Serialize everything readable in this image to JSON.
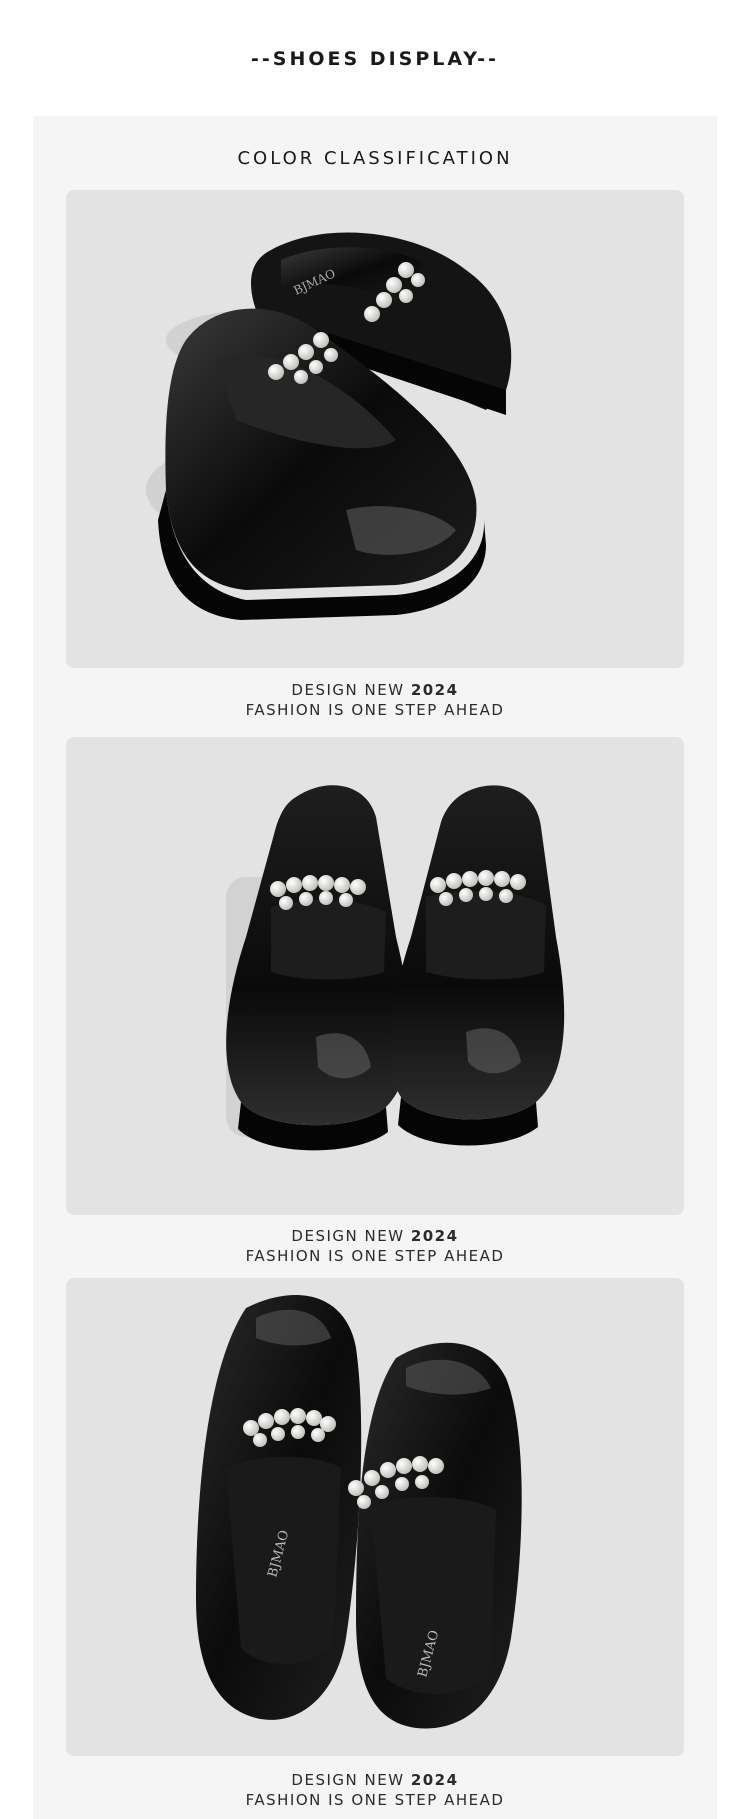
{
  "header": {
    "title": "--SHOES DISPLAY--"
  },
  "section": {
    "title": "COLOR CLASSIFICATION"
  },
  "brand": {
    "logo_text": "BJMAO"
  },
  "products": [
    {
      "view": "side-angle",
      "caption_line1_prefix": "DESIGN NEW ",
      "caption_line1_year": "2024",
      "caption_line2": "FASHION IS ONE STEP AHEAD"
    },
    {
      "view": "front",
      "caption_line1_prefix": "DESIGN NEW ",
      "caption_line1_year": "2024",
      "caption_line2": "FASHION IS ONE STEP AHEAD"
    },
    {
      "view": "top-down",
      "caption_line1_prefix": "DESIGN NEW ",
      "caption_line1_year": "2024",
      "caption_line2": "FASHION IS ONE STEP AHEAD"
    }
  ],
  "colors": {
    "background": "#ffffff",
    "panel": "#f5f5f5",
    "photo_bg": "#e3e3e3",
    "shoe": "#0d0d0d",
    "pearl": "#f2f2f0"
  }
}
